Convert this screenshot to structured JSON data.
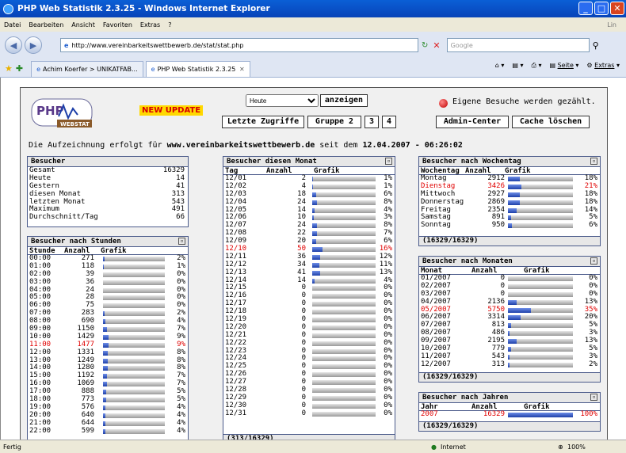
{
  "window": {
    "title": "PHP Web Statistik 2.3.25 - Windows Internet Explorer"
  },
  "menu": [
    "Datei",
    "Bearbeiten",
    "Ansicht",
    "Favoriten",
    "Extras",
    "?"
  ],
  "menu_right": "Lin",
  "address": {
    "url": "http://www.vereinbarkeitswettbewerb.de/stat/stat.php",
    "search_placeholder": "Google"
  },
  "tabs": [
    "Achim Koerfer > UNIKATFAB...",
    "PHP Web Statistik 2.3.25"
  ],
  "tab_tools": [
    "Seite",
    "Extras"
  ],
  "status": {
    "left": "Fertig",
    "zone": "Internet",
    "zoom": "100%"
  },
  "page": {
    "new_update": "NEW UPDATE",
    "period_selected": "Heute",
    "show_btn": "anzeigen",
    "nav": [
      "Letzte Zugriffe",
      "Gruppe 2",
      "3",
      "4"
    ],
    "admin": "Admin-Center",
    "cache": "Cache löschen",
    "own_visits": "Eigene Besuche werden gezählt.",
    "recording_prefix": "Die Aufzeichnung erfolgt für",
    "recording_site": "www.vereinbarkeitswettbewerb.de",
    "recording_mid": "seit dem",
    "recording_date": "12.04.2007 - 06:26:02"
  },
  "besucher": {
    "title": "Besucher",
    "rows": [
      [
        "Gesamt",
        "16329"
      ],
      [
        "Heute",
        "14"
      ],
      [
        "Gestern",
        "41"
      ],
      [
        "diesen Monat",
        "313"
      ],
      [
        "letzten Monat",
        "543"
      ],
      [
        "Maximum",
        "491"
      ],
      [
        "Durchschnitt/Tag",
        "66"
      ]
    ]
  },
  "stunden": {
    "title": "Besucher nach Stunden",
    "cols": [
      "Stunde",
      "Anzahl",
      "Grafik"
    ],
    "rows": [
      [
        "00:00",
        "271",
        2
      ],
      [
        "01:00",
        "118",
        1
      ],
      [
        "02:00",
        "39",
        0
      ],
      [
        "03:00",
        "36",
        0
      ],
      [
        "04:00",
        "24",
        0
      ],
      [
        "05:00",
        "28",
        0
      ],
      [
        "06:00",
        "75",
        0
      ],
      [
        "07:00",
        "283",
        2
      ],
      [
        "08:00",
        "690",
        4
      ],
      [
        "09:00",
        "1150",
        7
      ],
      [
        "10:00",
        "1429",
        9
      ],
      [
        "11:00",
        "1477",
        9
      ],
      [
        "12:00",
        "1331",
        8
      ],
      [
        "13:00",
        "1249",
        8
      ],
      [
        "14:00",
        "1280",
        8
      ],
      [
        "15:00",
        "1192",
        7
      ],
      [
        "16:00",
        "1069",
        7
      ],
      [
        "17:00",
        "888",
        5
      ],
      [
        "18:00",
        "773",
        5
      ],
      [
        "19:00",
        "576",
        4
      ],
      [
        "20:00",
        "640",
        4
      ],
      [
        "21:00",
        "644",
        4
      ],
      [
        "22:00",
        "599",
        4
      ]
    ],
    "highlight": "11:00"
  },
  "monat": {
    "title": "Besucher diesen Monat",
    "cols": [
      "Tag",
      "Anzahl",
      "Grafik"
    ],
    "rows": [
      [
        "12/01",
        "2",
        1
      ],
      [
        "12/02",
        "4",
        1
      ],
      [
        "12/03",
        "18",
        6
      ],
      [
        "12/04",
        "24",
        8
      ],
      [
        "12/05",
        "14",
        4
      ],
      [
        "12/06",
        "10",
        3
      ],
      [
        "12/07",
        "24",
        8
      ],
      [
        "12/08",
        "22",
        7
      ],
      [
        "12/09",
        "20",
        6
      ],
      [
        "12/10",
        "50",
        16
      ],
      [
        "12/11",
        "36",
        12
      ],
      [
        "12/12",
        "34",
        11
      ],
      [
        "12/13",
        "41",
        13
      ],
      [
        "12/14",
        "14",
        4
      ],
      [
        "12/15",
        "0",
        0
      ],
      [
        "12/16",
        "0",
        0
      ],
      [
        "12/17",
        "0",
        0
      ],
      [
        "12/18",
        "0",
        0
      ],
      [
        "12/19",
        "0",
        0
      ],
      [
        "12/20",
        "0",
        0
      ],
      [
        "12/21",
        "0",
        0
      ],
      [
        "12/22",
        "0",
        0
      ],
      [
        "12/23",
        "0",
        0
      ],
      [
        "12/24",
        "0",
        0
      ],
      [
        "12/25",
        "0",
        0
      ],
      [
        "12/26",
        "0",
        0
      ],
      [
        "12/27",
        "0",
        0
      ],
      [
        "12/28",
        "0",
        0
      ],
      [
        "12/29",
        "0",
        0
      ],
      [
        "12/30",
        "0",
        0
      ],
      [
        "12/31",
        "0",
        0
      ]
    ],
    "highlight": "12/10",
    "footer": "(313/16329)"
  },
  "wochentag": {
    "title": "Besucher nach Wochentag",
    "cols": [
      "Wochentag",
      "Anzahl",
      "Grafik"
    ],
    "rows": [
      [
        "Montag",
        "2912",
        18
      ],
      [
        "Dienstag",
        "3426",
        21
      ],
      [
        "Mittwoch",
        "2927",
        18
      ],
      [
        "Donnerstag",
        "2869",
        18
      ],
      [
        "Freitag",
        "2354",
        14
      ],
      [
        "Samstag",
        "891",
        5
      ],
      [
        "Sonntag",
        "950",
        6
      ]
    ],
    "highlight": "Dienstag",
    "footer": "(16329/16329)"
  },
  "monate": {
    "title": "Besucher nach Monaten",
    "cols": [
      "Monat",
      "Anzahl",
      "Grafik"
    ],
    "rows": [
      [
        "01/2007",
        "0",
        0
      ],
      [
        "02/2007",
        "0",
        0
      ],
      [
        "03/2007",
        "0",
        0
      ],
      [
        "04/2007",
        "2136",
        13
      ],
      [
        "05/2007",
        "5750",
        35
      ],
      [
        "06/2007",
        "3314",
        20
      ],
      [
        "07/2007",
        "813",
        5
      ],
      [
        "08/2007",
        "486",
        3
      ],
      [
        "09/2007",
        "2195",
        13
      ],
      [
        "10/2007",
        "779",
        5
      ],
      [
        "11/2007",
        "543",
        3
      ],
      [
        "12/2007",
        "313",
        2
      ]
    ],
    "highlight": "05/2007",
    "footer": "(16329/16329)"
  },
  "jahre": {
    "title": "Besucher nach Jahren",
    "cols": [
      "Jahr",
      "Anzahl",
      "Grafik"
    ],
    "rows": [
      [
        "2007",
        "16329",
        100
      ]
    ],
    "highlight": "2007",
    "footer": "(16329/16329)"
  }
}
